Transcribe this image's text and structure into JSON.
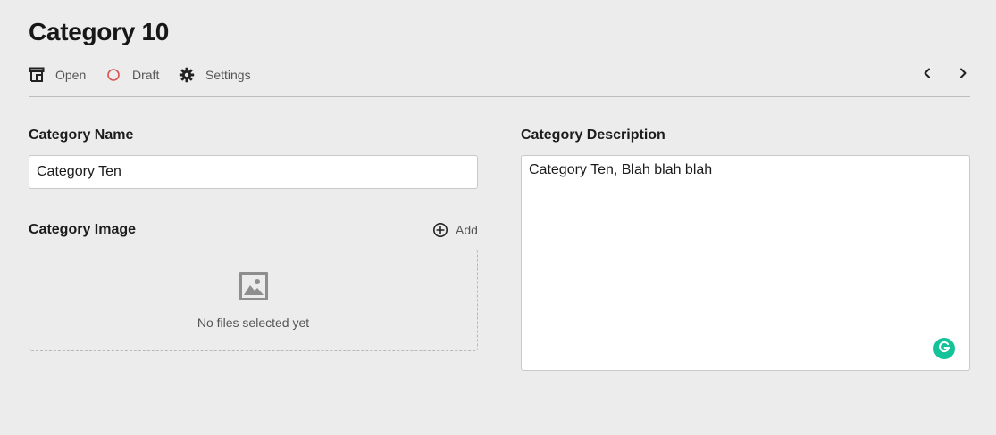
{
  "page": {
    "title": "Category 10"
  },
  "toolbar": {
    "open_label": "Open",
    "open_icon": "open-storefront-icon",
    "draft_label": "Draft",
    "draft_icon": "circle-outline-icon",
    "draft_color": "#d9534f",
    "settings_label": "Settings",
    "settings_icon": "gear-icon",
    "prev_icon": "chevron-left-icon",
    "next_icon": "chevron-right-icon"
  },
  "form": {
    "name": {
      "label": "Category Name",
      "value": "Category Ten"
    },
    "image": {
      "label": "Category Image",
      "add_label": "Add",
      "add_icon": "plus-circle-icon",
      "empty_icon": "image-placeholder-icon",
      "empty_text": "No files selected yet"
    },
    "description": {
      "label": "Category Description",
      "value": "Category Ten, Blah blah blah"
    }
  },
  "colors": {
    "background": "#ececec",
    "grammarly": "#15c39a"
  }
}
